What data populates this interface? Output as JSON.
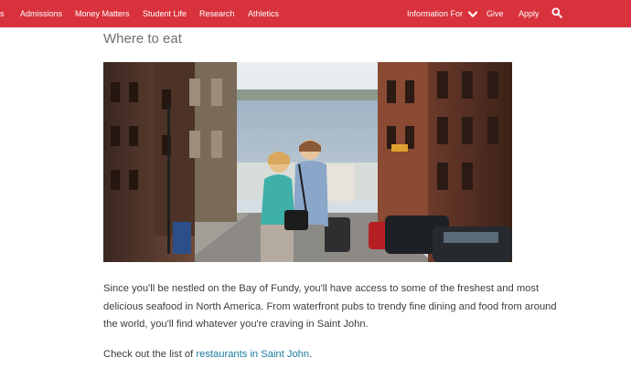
{
  "nav": {
    "left_items": [
      "s",
      "Admissions",
      "Money Matters",
      "Student Life",
      "Research",
      "Athletics"
    ],
    "information_for": "Information For",
    "give": "Give",
    "apply": "Apply"
  },
  "content": {
    "heading": "Where to eat",
    "paragraph": "Since you'll be nestled on the Bay of Fundy, you'll have access to some of the freshest and most delicious seafood in North America. From waterfront pubs to trendy fine dining and food from around the world, you'll find whatever you're craving in Saint John.",
    "cta_prefix": "Check out the list of ",
    "cta_link": "restaurants in Saint John",
    "cta_suffix": "."
  },
  "colors": {
    "brand_red": "#d8323c",
    "link": "#1a7aa0"
  },
  "icons": [
    "chevron-down-icon",
    "search-icon"
  ]
}
